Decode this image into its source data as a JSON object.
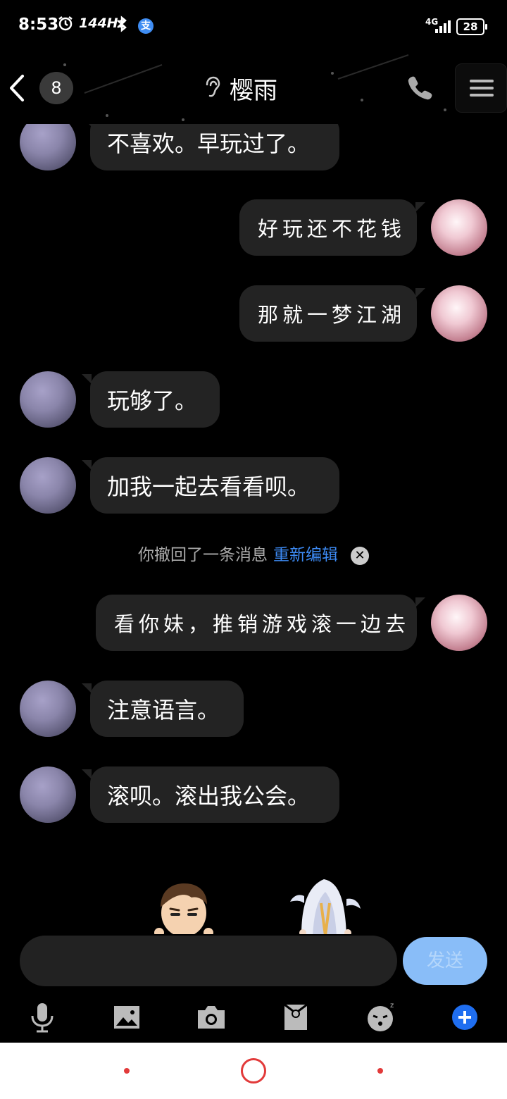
{
  "status_bar": {
    "time": "8:53",
    "refresh_rate": "144Hz",
    "alipay_glyph": "支",
    "network": "4G",
    "battery": "28"
  },
  "header": {
    "unread_count": "8",
    "contact_name": "樱雨"
  },
  "messages": [
    {
      "side": "left",
      "text": "不喜欢。早玩过了。"
    },
    {
      "side": "right",
      "text": "好玩还不花钱"
    },
    {
      "side": "right",
      "text": "那就一梦江湖"
    },
    {
      "side": "left",
      "text": "玩够了。"
    },
    {
      "side": "left",
      "text": "加我一起去看看呗。"
    },
    {
      "side": "right",
      "text": "看你妹，推销游戏滚一边去"
    },
    {
      "side": "left",
      "text": "注意语言。"
    },
    {
      "side": "left",
      "text": "滚呗。滚出我公会。"
    }
  ],
  "recall_notice": {
    "text": "你撤回了一条消息",
    "edit_link": "重新编辑"
  },
  "composer": {
    "placeholder": "",
    "send_label": "发送"
  },
  "toolbar_icons": [
    "mic-icon",
    "image-icon",
    "camera-icon",
    "red-packet-icon",
    "emoji-icon",
    "plus-icon"
  ],
  "colors": {
    "accent": "#3d8bf5",
    "bubble": "#232323",
    "send_button": "#89bdf8",
    "nav_accent": "#e23a3a"
  }
}
